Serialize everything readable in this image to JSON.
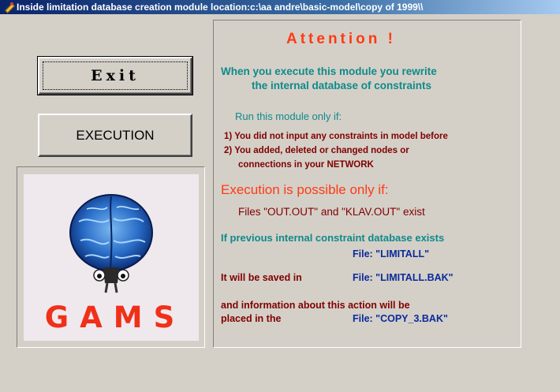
{
  "window": {
    "title": "Inside limitation database creation module  location:c:\\aa andre\\basic-model\\copy of 1999\\\\",
    "icon": "pen-icon"
  },
  "buttons": {
    "exit_label": "Exit",
    "execution_label": "EXECUTION"
  },
  "logo": {
    "text": "GAMS",
    "image": "brain-icon"
  },
  "info": {
    "heading": "Attention !",
    "line1": "When you execute this module you rewrite",
    "line2": "the internal database of constraints",
    "run_only_if": "Run this module only if:",
    "cond1": "1) You did not input any constraints in model before",
    "cond2": "2) You added, deleted or changed nodes or",
    "cond3": "connections in your NETWORK",
    "exec_possible": "Execution is possible only if:",
    "files_exist": "Files \"OUT.OUT\" and \"KLAV.OUT\" exist",
    "prev_db": "If previous internal constraint database exists",
    "file_limitall": "File: \"LIMITALL\"",
    "saved_in": "It will be saved in",
    "file_limitall_bak": "File: \"LIMITALL.BAK\"",
    "and_info": "and information about this action will be",
    "placed_in": "placed in the",
    "file_copy_bak": "File: \"COPY_3.BAK\""
  },
  "colors": {
    "teal": "#0f8a8a",
    "red": "#ff3a14",
    "dark_red": "#800000",
    "navy": "#0a2a9a",
    "face": "#d4d0c8"
  }
}
